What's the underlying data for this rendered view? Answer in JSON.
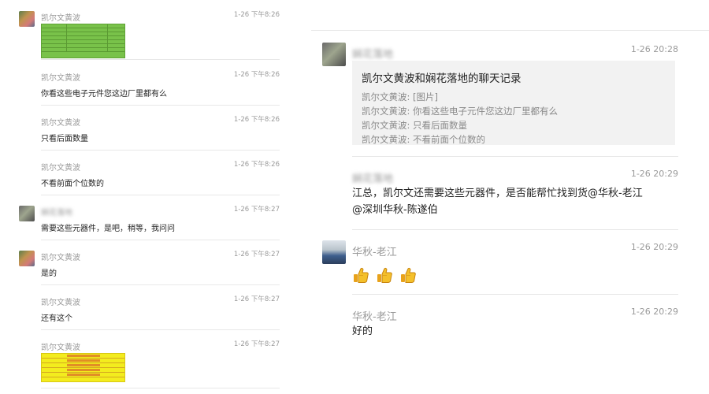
{
  "left": {
    "messages": [
      {
        "name": "凯尔文黄波",
        "time": "1-26 下午8:26",
        "text": "",
        "attachment": "green-spreadsheet-image"
      },
      {
        "name": "凯尔文黄波",
        "time": "1-26 下午8:26",
        "text": "你看这些电子元件您这边厂里都有么"
      },
      {
        "name": "凯尔文黄波",
        "time": "1-26 下午8:26",
        "text": "只看后面数量"
      },
      {
        "name": "凯尔文黄波",
        "time": "1-26 下午8:26",
        "text": "不看前面个位数的"
      },
      {
        "name": "娴花落地",
        "time": "1-26 下午8:27",
        "text": "需要这些元器件，是吧，稍等，我问问"
      },
      {
        "name": "凯尔文黄波",
        "time": "1-26 下午8:27",
        "text": "是的"
      },
      {
        "name": "凯尔文黄波",
        "time": "1-26 下午8:27",
        "text": "还有这个"
      },
      {
        "name": "凯尔文黄波",
        "time": "1-26 下午8:27",
        "text": "",
        "attachment": "yellow-spreadsheet-image"
      }
    ]
  },
  "right": {
    "record": {
      "sender": "娴花落地",
      "time": "1-26 20:28",
      "title": "凯尔文黄波和娴花落地的聊天记录",
      "lines": [
        "凯尔文黄波: [图片]",
        "凯尔文黄波: 你看这些电子元件您这边厂里都有么",
        "凯尔文黄波: 只看后面数量",
        "凯尔文黄波: 不看前面个位数的"
      ]
    },
    "msg2": {
      "sender": "娴花落地",
      "time": "1-26 20:29",
      "line1": "江总，凯尔文还需要这些元器件，是否能帮忙找到货@华秋-老江",
      "line2": "@深圳华秋-陈遂伯"
    },
    "msg3": {
      "sender": "华秋-老江",
      "time": "1-26 20:29",
      "icon": "thumbs-up-icon"
    },
    "msg4": {
      "sender": "华秋-老江",
      "time": "1-26 20:29",
      "text": "好的"
    }
  },
  "colors": {
    "green_sheet": "#79c24a",
    "yellow_sheet": "#f3ec1e",
    "card_bg": "#f2f2f2",
    "meta_text": "#9a9a9a"
  }
}
